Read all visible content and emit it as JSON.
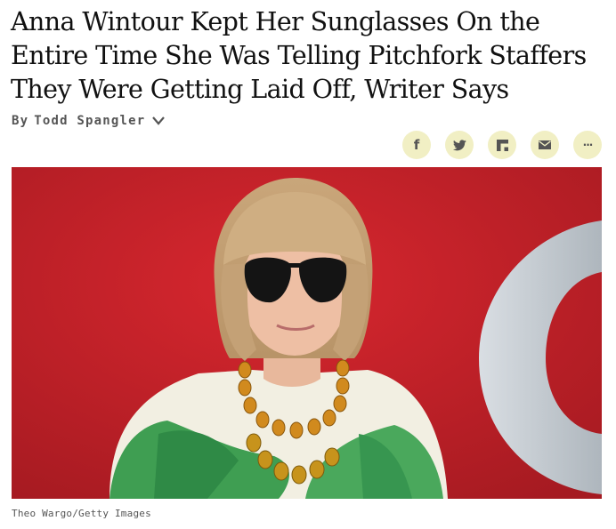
{
  "article": {
    "headline": "Anna Wintour Kept Her Sunglasses On the Entire Time She Was Telling Pitchfork Staffers They Were Getting Laid Off, Writer Says",
    "byline_prefix": "By",
    "author": "Todd Spangler",
    "photo_credit": "Theo Wargo/Getty Images"
  },
  "share": {
    "buttons": [
      {
        "icon": "facebook-icon",
        "glyph": "f"
      },
      {
        "icon": "twitter-icon"
      },
      {
        "icon": "flipboard-icon"
      },
      {
        "icon": "email-icon"
      },
      {
        "icon": "more-icon",
        "glyph": "···"
      }
    ]
  },
  "colors": {
    "share_bg": "#f1efc4",
    "photo_red": "#c8232b",
    "byline": "#555555"
  }
}
